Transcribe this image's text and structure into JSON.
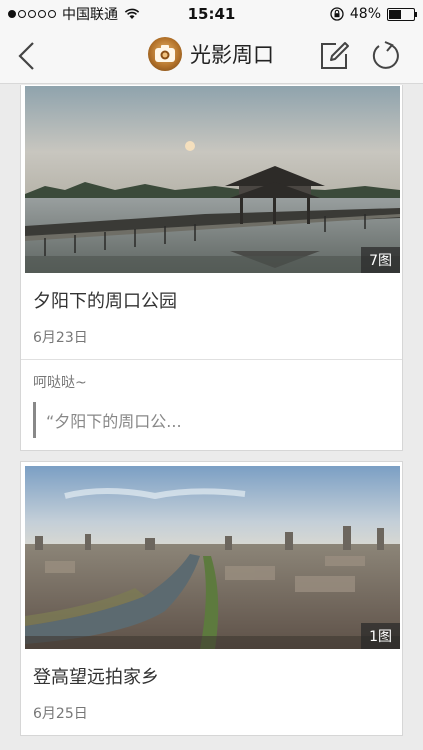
{
  "status_bar": {
    "carrier": "中国联通",
    "time": "15:41",
    "battery_percent": "48%",
    "battery_level": 0.48,
    "signal_bars_filled": 1,
    "signal_bars_total": 5
  },
  "nav": {
    "title": "光影周口",
    "back_icon": "chevron-left-icon",
    "edit_icon": "edit-icon",
    "refresh_icon": "refresh-icon"
  },
  "cards": [
    {
      "photo_count": "7图",
      "title": "夕阳下的周口公园",
      "date": "6月23日",
      "comment": {
        "user": "呵哒哒~",
        "quote": "“夕阳下的周口公..."
      }
    },
    {
      "photo_count": "1图",
      "title": "登高望远拍家乡",
      "date": "6月25日"
    }
  ],
  "colors": {
    "background": "#ebebeb",
    "bar": "#f7f7f7",
    "text": "#333333",
    "muted": "#777777"
  }
}
